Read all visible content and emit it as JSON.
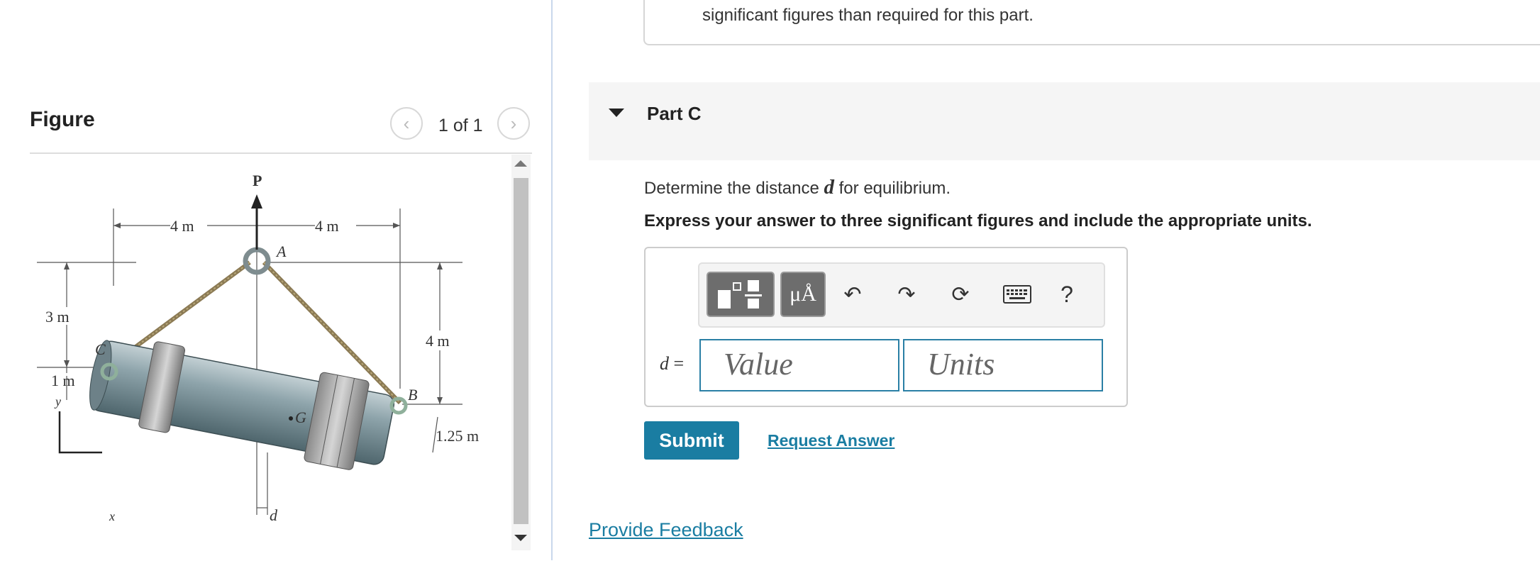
{
  "figure_panel": {
    "title": "Figure",
    "page_indicator": "1 of 1",
    "prev_icon": "chevron-left-icon",
    "next_icon": "chevron-right-icon",
    "diagram_labels": {
      "force": "P",
      "point_a": "A",
      "point_b": "B",
      "point_c": "C",
      "center": "G",
      "dim_left": "4 m",
      "dim_right": "4 m",
      "dim_3m": "3 m",
      "dim_1m": "1 m",
      "dim_4m_vertical": "4 m",
      "dim_125m": "1.25 m",
      "dim_d": "d",
      "axis_x": "x",
      "axis_y": "y"
    }
  },
  "previous_part": {
    "note": "significant figures than required for this part."
  },
  "part_c": {
    "title": "Part C",
    "question_prefix": "Determine the distance ",
    "question_var": "d",
    "question_suffix": " for equilibrium.",
    "instruction": "Express your answer to three significant figures and include the appropriate units.",
    "toolbar": {
      "template_icon": "templates-icon",
      "units_label": "μÅ",
      "undo_icon": "undo-icon",
      "redo_icon": "redo-icon",
      "reset_icon": "reset-icon",
      "keyboard_icon": "keyboard-icon",
      "help_label": "?"
    },
    "answer_var": "d",
    "answer_eq": " =",
    "value_placeholder": "Value",
    "units_placeholder": "Units",
    "submit_label": "Submit",
    "request_answer_label": "Request Answer"
  },
  "feedback_label": "Provide Feedback",
  "colors": {
    "accent": "#1a7da2",
    "field_border": "#2a7fa5",
    "toolbar_dark": "#6d6d6d"
  }
}
